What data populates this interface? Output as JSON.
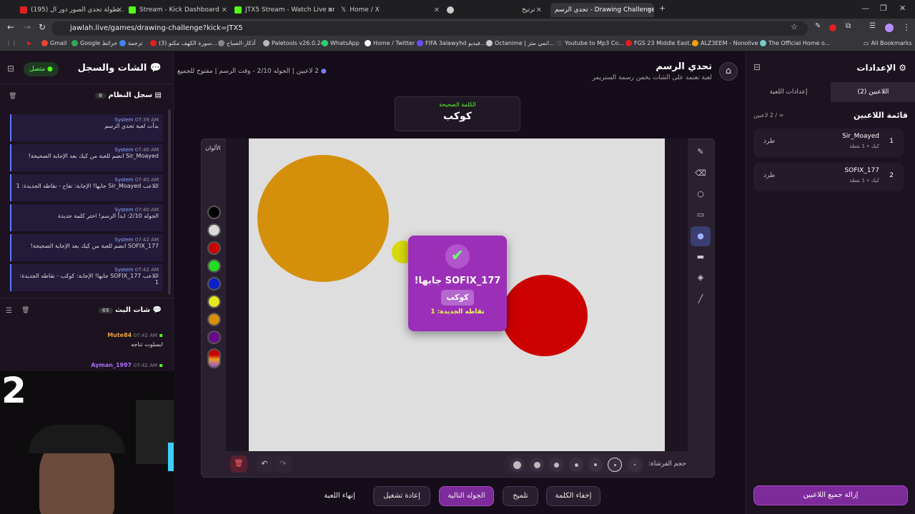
{
  "browser": {
    "tabs": [
      {
        "title": "(195) بطولة تحدي الصور دور ال...",
        "color": "#e02020"
      },
      {
        "title": "Stream - Kick Dashboard",
        "color": "#53fc18"
      },
      {
        "title": "JTX5 Stream - Watch Live on Kic",
        "color": "#53fc18"
      },
      {
        "title": "Home / X",
        "color": "#ffffff"
      },
      {
        "title": "",
        "color": "#cccccc"
      },
      {
        "title": "ترتيح",
        "color": "#888888"
      },
      {
        "title": "تحدي الرسم - Drawing Challenge",
        "color": "#cccccc"
      }
    ],
    "url": "jawlah.live/games/drawing-challenge?kick=JTX5",
    "bookmarks": [
      "Gmail",
      "Google خرائط",
      "ترجمة",
      "(3) سورة الكهف مكتو...",
      "أذكار-الصباح",
      "Paletools v26.0.24",
      "WhatsApp",
      "Home / Twitter",
      "FIFA 3alawyhd فيديو...",
      "Octanime | انمي متر...",
      "Youtube to Mp3 Co...",
      "FGS 23 Middle East...",
      "ALZ3EEM - Nonolive",
      "The Official Home o...",
      "All Bookmarks"
    ]
  },
  "left": {
    "title": "الشات والسجل",
    "status": "متصل",
    "system_log": {
      "title": "سجل النظام",
      "count": "6",
      "items": [
        {
          "time": "07:39 AM",
          "author": "System",
          "text": "بدأت لعبة تحدي الرسم"
        },
        {
          "time": "07:40 AM",
          "author": "System",
          "text": "Sir_Moayed انضم للعبة من كيك بعد الإجابة الصحيحة!"
        },
        {
          "time": "07:40 AM",
          "author": "System",
          "text": "اللاعب Sir_Moayed جابها! الإجابة: تفاح - نقاطه الجديدة: 1"
        },
        {
          "time": "07:40 AM",
          "author": "System",
          "text": "الجوله 2/10: ابدأ الرسم! اختر كلمة جديدة"
        },
        {
          "time": "07:42 AM",
          "author": "System",
          "text": "SOFIX_177 انضم للعبة من كيك بعد الإجابة الصحيحة!"
        },
        {
          "time": "07:42 AM",
          "author": "System",
          "text": "اللاعب SOFIX_177 جابها! الإجابة: كوكب - نقاطه الجديدة: 1"
        }
      ]
    },
    "stream_chat": {
      "title": "شات البث",
      "count": "65",
      "items": [
        {
          "time": "07:42 AM",
          "author": "Mute84",
          "text": "ابسلوت تناجه"
        },
        {
          "time": "07:42 AM",
          "author": "Ayman_1997",
          "text": ""
        }
      ]
    },
    "overlay_number": "2"
  },
  "header": {
    "title": "تحدي الرسم",
    "subtitle": "لعبة تعتمد على الشات يخمن رسمة الستريمر",
    "players": "2 لاعبين",
    "round": "الجوله 2/10 - وقت الرسم",
    "mode": "مفتوح للجميع"
  },
  "word": {
    "label": "الكلمة الصحيحة",
    "value": "كوكب"
  },
  "palette": {
    "title": "الألوان",
    "colors": [
      "#000000",
      "#d9d9d9",
      "#cc0000",
      "#22dd22",
      "#0a1fcc",
      "#e8e81a",
      "#d88f0c",
      "#6a0a8a"
    ]
  },
  "popup": {
    "title": "SOFIX_177 جابها!",
    "word": "كوكب",
    "points": "نقاطه الجديدة: 1"
  },
  "canvas_shapes": [
    {
      "shape": "circle",
      "color": "#d4900b"
    },
    {
      "shape": "circle",
      "color": "#d8d80e"
    },
    {
      "shape": "circle",
      "color": "#cc0000"
    }
  ],
  "toolbar": {
    "brush_size_label": "حجم الفرشاة:"
  },
  "actions": {
    "end": "إنهاء اللعبة",
    "restart": "إعادة تشغيل",
    "next": "الجوله التالية",
    "hint": "تلميح",
    "hide": "إخفاء الكلمة"
  },
  "right": {
    "title": "الإعدادات",
    "tab_players": "اللاعبين (2)",
    "tab_settings": "إعدادات اللعبة",
    "list_title": "قائمة اللاعبين",
    "list_count": "∞ / 2 لاعبين",
    "players": [
      {
        "rank": "1",
        "name": "Sir_Moayed",
        "meta": "كيك • 1 نقطة",
        "kick": "طرد"
      },
      {
        "rank": "2",
        "name": "SOFIX_177",
        "meta": "كيك • 1 نقطة",
        "kick": "طرد"
      }
    ],
    "remove_all": "إزالة جميع اللاعبين"
  },
  "colors": {
    "accent": "#9c2fb8",
    "purple": "#7d2a9a",
    "green": "#53fc18"
  }
}
